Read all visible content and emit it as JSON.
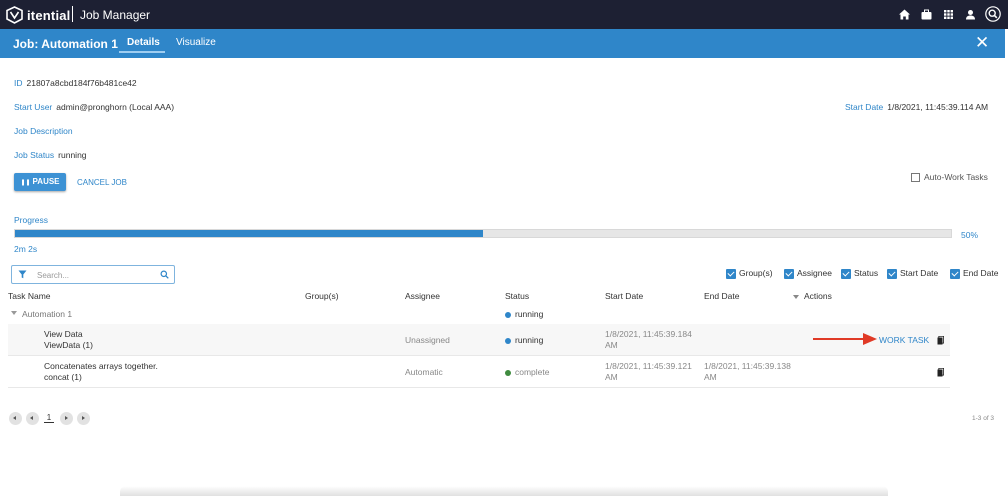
{
  "brand": "itential",
  "app_title": "Job Manager",
  "nav_icons": [
    "home-icon",
    "briefcase-icon",
    "apps-grid-icon",
    "user-icon",
    "search-icon"
  ],
  "job": {
    "title": "Job: Automation 1",
    "tabs": [
      "Details",
      "Visualize"
    ],
    "active_tab": "Details",
    "close_symbol": "✕"
  },
  "details": {
    "id_label": "ID",
    "id_value": "21807a8cbd184f76b481ce42",
    "start_user_label": "Start User",
    "start_user_value": "admin@pronghorn (Local AAA)",
    "start_date_label": "Start Date",
    "start_date_value": "1/8/2021, 11:45:39.114 AM",
    "description_label": "Job Description",
    "status_label": "Job Status",
    "status_value": "running"
  },
  "actions": {
    "pause_icon": "❚❚",
    "pause_label": "PAUSE",
    "cancel_label": "CANCEL JOB",
    "auto_work_label": "Auto-Work Tasks",
    "auto_work_checked": false
  },
  "progress": {
    "label": "Progress",
    "percent": 50,
    "percent_text": "50%",
    "elapsed": "2m 2s"
  },
  "search": {
    "placeholder": "Search..."
  },
  "column_toggles": [
    "Group(s)",
    "Assignee",
    "Status",
    "Start Date",
    "End Date"
  ],
  "table": {
    "headers": [
      "Task Name",
      "Group(s)",
      "Assignee",
      "Status",
      "Start Date",
      "End Date",
      "Actions"
    ],
    "group": {
      "name": "Automation 1",
      "status": "running"
    },
    "rows": [
      {
        "name": "View Data",
        "sub": "ViewData (1)",
        "assignee": "Unassigned",
        "status": "running",
        "start_line1": "1/8/2021, 11:45:39.184",
        "start_line2": "AM",
        "end_line1": "",
        "end_line2": "",
        "action": "WORK TASK"
      },
      {
        "name": "Concatenates arrays together.",
        "sub": "concat (1)",
        "assignee": "Automatic",
        "status": "complete",
        "start_line1": "1/8/2021, 11:45:39.121",
        "start_line2": "AM",
        "end_line1": "1/8/2021, 11:45:39.138",
        "end_line2": "AM",
        "action": ""
      }
    ]
  },
  "pagination": {
    "page": "1",
    "range": "1-3 of 3"
  },
  "colors": {
    "topbar": "#1d2033",
    "accent": "#2f86c9",
    "running": "#2f86c9",
    "complete": "#3f8b3f",
    "annotation_arrow": "#e03a26"
  }
}
